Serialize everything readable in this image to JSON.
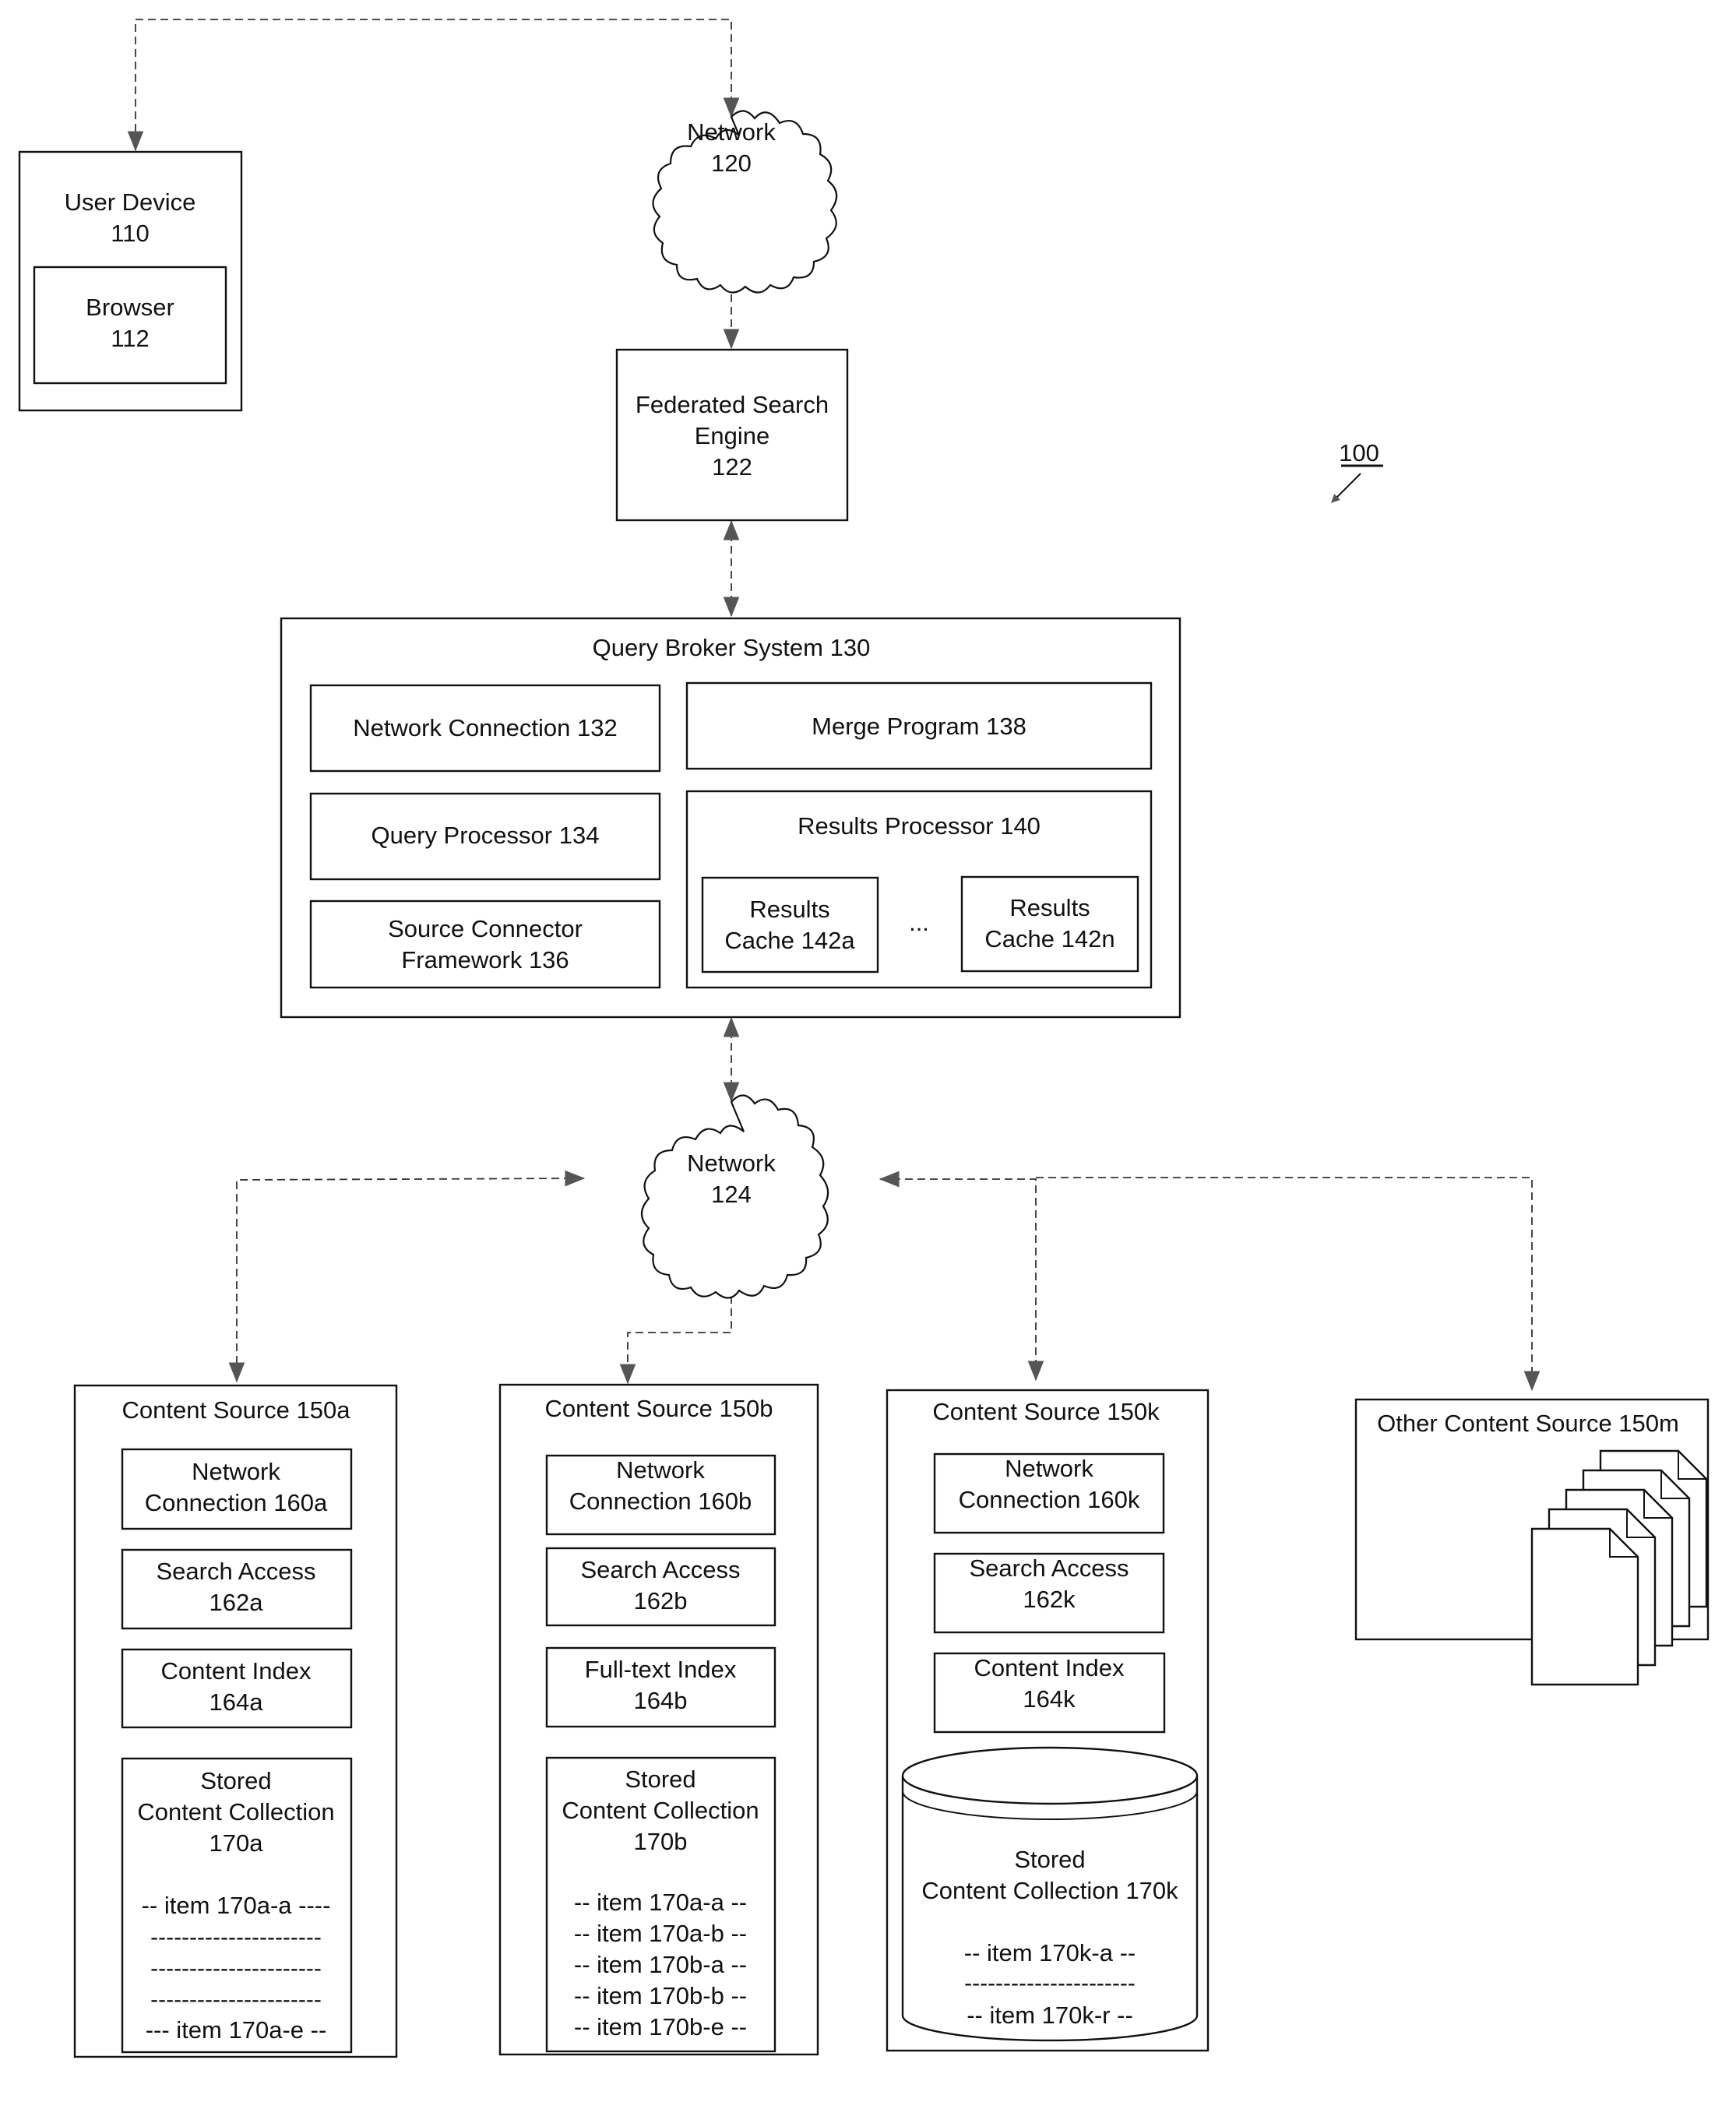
{
  "figure_ref": "100",
  "user_device": {
    "title": "User Device",
    "ref": "110",
    "browser": {
      "title": "Browser",
      "ref": "112"
    }
  },
  "network_top": {
    "title": "Network",
    "ref": "120"
  },
  "federated_search_engine": {
    "line1": "Federated Search",
    "line2": "Engine",
    "ref": "122"
  },
  "query_broker": {
    "title": "Query Broker System 130",
    "network_connection": "Network Connection 132",
    "query_processor": "Query Processor 134",
    "source_connector": {
      "line1": "Source Connector",
      "line2": "Framework 136"
    },
    "merge_program": "Merge Program 138",
    "results_processor": {
      "title": "Results Processor 140",
      "cache_a": {
        "line1": "Results",
        "line2": "Cache 142a"
      },
      "ellipsis": "...",
      "cache_n": {
        "line1": "Results",
        "line2": "Cache 142n"
      }
    }
  },
  "network_bottom": {
    "title": "Network",
    "ref": "124"
  },
  "content_sources": [
    {
      "title": "Content Source 150a",
      "network_connection": {
        "line1": "Network",
        "line2": "Connection 160a"
      },
      "search_access": {
        "line1": "Search Access",
        "line2": "162a"
      },
      "index": {
        "line1": "Content Index",
        "line2": "164a"
      },
      "collection": {
        "line1": "Stored",
        "line2": "Content Collection",
        "line3": "170a",
        "items": [
          "-- item 170a-a ----",
          "----------------------",
          "----------------------",
          "----------------------",
          "--- item 170a-e --"
        ]
      }
    },
    {
      "title": "Content Source 150b",
      "network_connection": {
        "line1": "Network",
        "line2": "Connection 160b"
      },
      "search_access": {
        "line1": "Search Access",
        "line2": "162b"
      },
      "index": {
        "line1": "Full-text Index",
        "line2": "164b"
      },
      "collection": {
        "line1": "Stored",
        "line2": "Content Collection",
        "line3": "170b",
        "items": [
          "-- item 170a-a --",
          "-- item 170a-b --",
          "-- item 170b-a --",
          "-- item 170b-b --",
          "-- item 170b-e --"
        ]
      }
    },
    {
      "title": "Content Source 150k",
      "network_connection": {
        "line1": "Network",
        "line2": "Connection 160k"
      },
      "search_access": {
        "line1": "Search Access",
        "line2": "162k"
      },
      "index": {
        "line1": "Content Index",
        "line2": "164k"
      },
      "collection": {
        "line1": "Stored",
        "line2": "Content Collection 170k",
        "items": [
          "-- item 170k-a --",
          "----------------------",
          "-- item 170k-r --"
        ]
      }
    }
  ],
  "other_source": {
    "title": "Other Content Source 150m",
    "document_count": 5
  }
}
